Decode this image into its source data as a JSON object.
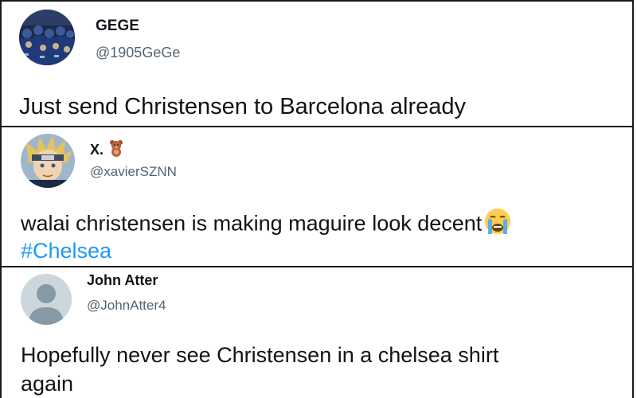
{
  "tweets": [
    {
      "name": "GEGE",
      "handle": "@1905GeGe",
      "text": "Just send Christensen to Barcelona already",
      "avatar_icon": "crowd-photo-avatar"
    },
    {
      "name": "X.",
      "name_emoji": "teddy-bear-icon",
      "handle": "@xavierSZNN",
      "text": "walai christensen is making maguire look decent",
      "text_emoji": "loudly-crying-face-icon",
      "hashtag": "#Chelsea",
      "avatar_icon": "anime-character-avatar"
    },
    {
      "name": "John Atter",
      "handle": "@JohnAtter4",
      "text_line1": "Hopefully never see Christensen in a chelsea shirt",
      "text_line2": "again",
      "avatar_icon": "default-profile-avatar"
    }
  ],
  "colors": {
    "handle": "#536471",
    "hashtag": "#1d9bf0",
    "text": "#0f1419",
    "default_avatar_bg": "#ccd6dd",
    "default_avatar_fg": "#8899a6"
  }
}
